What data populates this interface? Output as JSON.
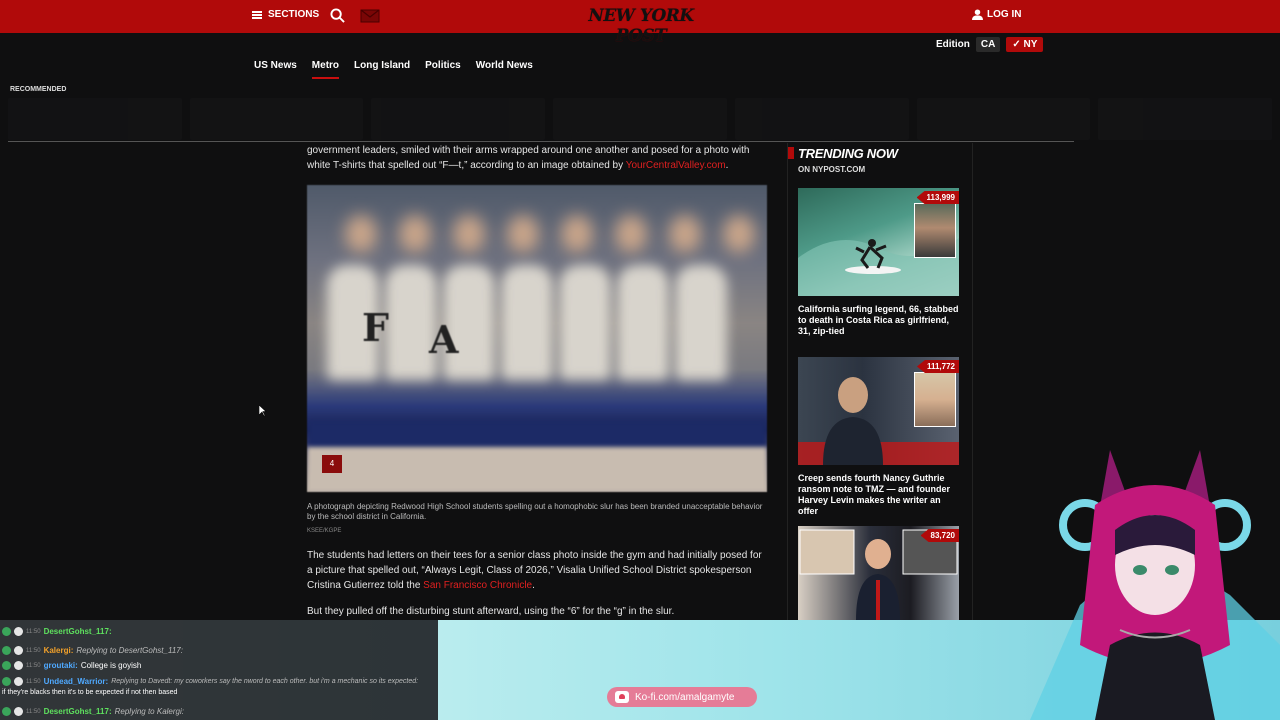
{
  "header": {
    "sections_label": "SECTIONS",
    "logo_text": "NEW YORK POST",
    "login_label": "LOG IN",
    "edition_label": "Edition",
    "edition_options": [
      "CA",
      "NY"
    ],
    "edition_selected": "NY"
  },
  "nav": {
    "items": [
      "US News",
      "Metro",
      "Long Island",
      "Politics",
      "World News"
    ],
    "active": "Metro"
  },
  "recommended_label": "RECOMMENDED",
  "article": {
    "para1_start": "government leaders, smiled with their arms wrapped around one another and posed for a photo with white T-shirts that spelled out “F—t,” according to an image obtained by ",
    "para1_link": "YourCentralValley.com",
    "para1_end": ".",
    "photo_count": "4",
    "photo_letters": [
      "F",
      "A"
    ],
    "caption": "A photograph depicting Redwood High School students spelling out a homophobic slur has been branded unacceptable behavior by the school district in California.",
    "credit": "KSEE/KGPE",
    "para2_start": "The students had letters on their tees for a senior class photo inside the gym and had initially posed for a picture that spelled out, “Always Legit, Class of 2026,” Visalia Unified School District spokesperson Cristina Gutierrez told the ",
    "para2_link": "San Francisco Chronicle",
    "para2_end": ".",
    "para3": "But they pulled off the disturbing stunt afterward, using the “6” for the “g” in the slur."
  },
  "trending": {
    "title": "TRENDING NOW",
    "subtitle": "ON NYPOST.COM",
    "stories": [
      {
        "count": "113,999",
        "title": "California surfing legend, 66, stabbed to death in Costa Rica as girlfriend, 31, zip-tied"
      },
      {
        "count": "111,772",
        "title": "Creep sends fourth Nancy Guthrie ransom note to TMZ — and founder Harvey Levin makes the writer an offer"
      },
      {
        "count": "83,720",
        "title": ""
      }
    ]
  },
  "chat": {
    "messages": [
      {
        "time": "11:50",
        "user": "DesertGohst_117:",
        "user_color": "green",
        "text": "",
        "reply": ""
      },
      {
        "time": "11:50",
        "user": "Kalergi:",
        "user_color": "orange",
        "text": "",
        "reply": "Replying to DesertGohst_117:"
      },
      {
        "time": "11:50",
        "user": "groutaki:",
        "user_color": "blue",
        "text": "College is goyish",
        "reply": ""
      },
      {
        "time": "11:50",
        "user": "Undead_Warrior:",
        "user_color": "blue",
        "text": "if they're blacks then it's to be expected if not then based",
        "reply": "Replying to Davedt: my coworkers say the nword to each other. but i'm a mechanic so its expected:"
      },
      {
        "time": "11:50",
        "user": "DesertGohst_117:",
        "user_color": "green",
        "text": "",
        "reply": "Replying to Kalergi:"
      }
    ]
  },
  "kofi_label": "Ko-fi.com/amalgamyte",
  "colors": {
    "brand_red": "#b10a0a",
    "link_red": "#e02020",
    "background": "#0f0f10",
    "kofi_pink": "#e57c97"
  }
}
